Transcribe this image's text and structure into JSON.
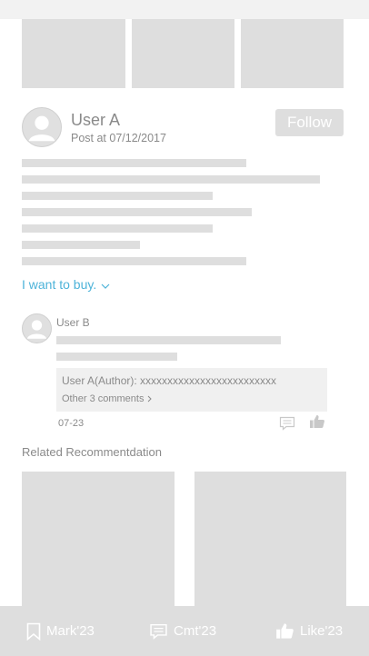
{
  "post": {
    "author": {
      "name": "User A",
      "date": "Post at 07/12/2017"
    },
    "follow_label": "Follow",
    "buy_link": "I want to buy."
  },
  "comment": {
    "user": "User B",
    "reply": "User A(Author):  xxxxxxxxxxxxxxxxxxxxxxxxx",
    "other_comments": "Other 3 comments",
    "date": "07-23"
  },
  "related": {
    "title": "Related Recommentdation"
  },
  "bottom_bar": {
    "mark": "Mark'23",
    "comment": "Cmt'23",
    "like": "Like'23"
  },
  "colors": {
    "placeholder": "#dedede",
    "accent": "#4db3d9",
    "text": "#8a8a8a"
  },
  "icons": [
    "avatar-placeholder",
    "chevron-down-icon",
    "chevron-right-icon",
    "comment-icon",
    "thumbs-up-icon",
    "bookmark-icon"
  ]
}
